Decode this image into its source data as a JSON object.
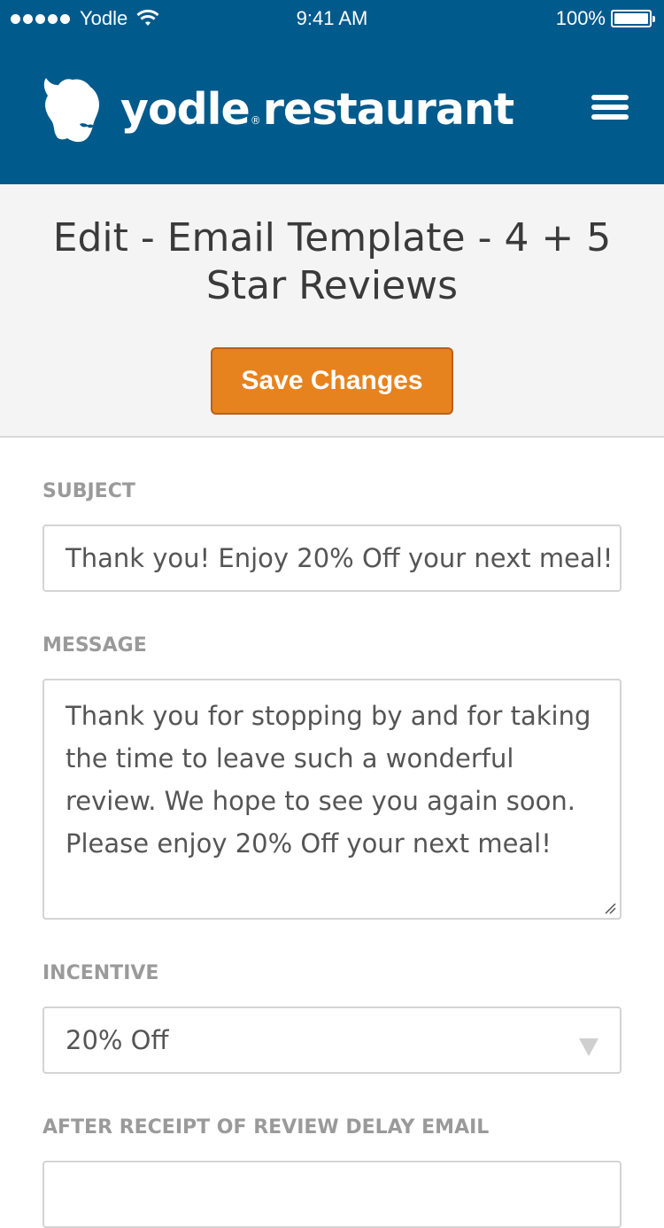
{
  "status_bar": {
    "carrier": "Yodle",
    "time": "9:41 AM",
    "battery": "100%",
    "signal_bars": 5
  },
  "header": {
    "brand_primary": "yodle",
    "brand_reg": "®",
    "brand_secondary": "restaurant",
    "logo_icon": "moose-head-icon",
    "menu_icon": "hamburger-menu-icon"
  },
  "page": {
    "title": "Edit - Email Template - 4 + 5 Star Reviews",
    "save_label": "Save Changes"
  },
  "form": {
    "subject": {
      "label": "SUBJECT",
      "value": "Thank you! Enjoy 20% Off your next meal!"
    },
    "message": {
      "label": "MESSAGE",
      "value": "Thank you for stopping by and for taking the time to leave such a wonderful review. We hope to see you again soon. Please enjoy 20% Off your next meal!"
    },
    "incentive": {
      "label": "INCENTIVE",
      "selected": "20% Off"
    },
    "delay": {
      "label": "AFTER RECEIPT OF REVIEW DELAY EMAIL",
      "value": ""
    }
  },
  "colors": {
    "header_bg": "#005a8c",
    "accent_button": "#e7831f",
    "panel_bg": "#f4f4f4",
    "label_gray": "#9a9a9a",
    "text_gray": "#555555"
  }
}
